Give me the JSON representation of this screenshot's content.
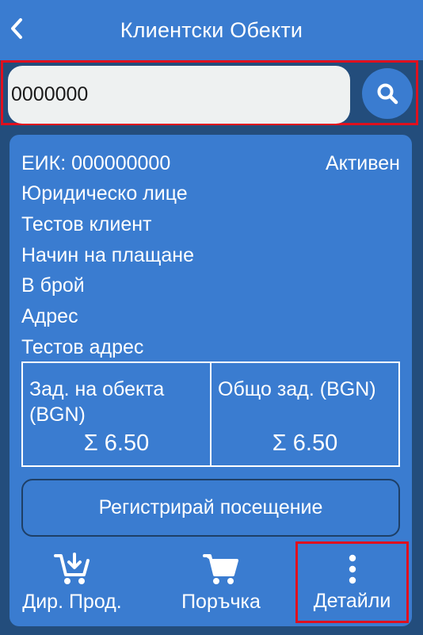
{
  "appbar": {
    "title": "Клиентски Обекти",
    "back_icon": "chevron-left-icon"
  },
  "search": {
    "value": "0000000",
    "icon": "search-icon"
  },
  "client": {
    "eik": "ЕИК: 000000000",
    "status": "Активен",
    "type": "Юридическо лице",
    "name": "Тестов клиент",
    "payment_label": "Начин на плащане",
    "payment_value": "В брой",
    "address_label": "Адрес",
    "address_value": "Тестов адрес"
  },
  "debts": {
    "object_label": "Зад. на обекта (BGN)",
    "object_value": "Σ 6.50",
    "total_label": "Общо зад. (BGN)",
    "total_value": "Σ 6.50"
  },
  "register_button": "Регистрирай посещение",
  "actions": [
    {
      "label": "Дир. Прод.",
      "icon": "cart-download-icon"
    },
    {
      "label": "Поръчка",
      "icon": "cart-icon"
    },
    {
      "label": "Детайли",
      "icon": "more-vertical-icon"
    }
  ],
  "colors": {
    "background": "#234d7c",
    "primary": "#3a7cd0",
    "highlight": "#e0101e"
  }
}
